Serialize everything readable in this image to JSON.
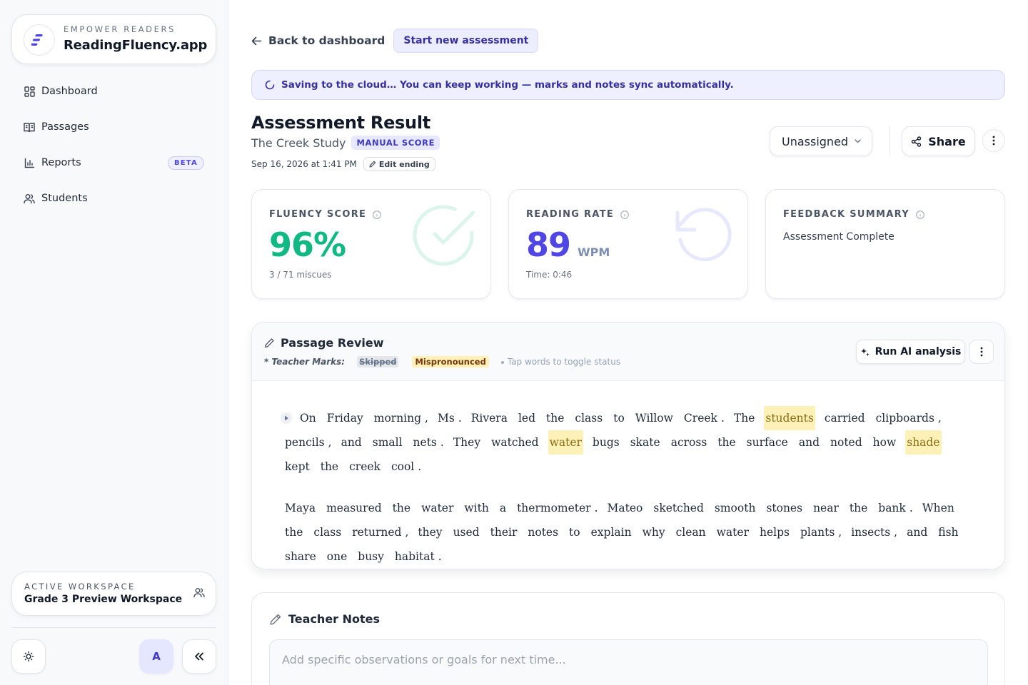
{
  "brand": {
    "kicker": "EMPOWER READERS",
    "name": "ReadingFluency.app"
  },
  "nav": [
    {
      "label": "Dashboard",
      "icon": "dashboard-grid-icon"
    },
    {
      "label": "Passages",
      "icon": "book-open-icon"
    },
    {
      "label": "Reports",
      "icon": "bar-chart-icon",
      "badge": "BETA"
    },
    {
      "label": "Students",
      "icon": "users-icon"
    }
  ],
  "workspace": {
    "kicker": "ACTIVE WORKSPACE",
    "name": "Grade 3 Preview Workspace"
  },
  "footer": {
    "avatar_letter": "A"
  },
  "topbar": {
    "back_label": "Back to dashboard",
    "new_label": "Start new assessment"
  },
  "sync_banner": "Saving to the cloud… You can keep working — marks and notes sync automatically.",
  "assessment": {
    "title": "Assessment Result",
    "passage_name": "The Creek Study",
    "score_badge": "MANUAL SCORE",
    "date": "Sep 16, 2026 at 1:41 PM",
    "edit_label": "Edit ending",
    "assignee": "Unassigned",
    "share_label": "Share"
  },
  "stats": {
    "fluency": {
      "label": "FLUENCY SCORE",
      "value": "96%",
      "foot": "3 / 71 miscues",
      "color": "#10b981"
    },
    "rate": {
      "label": "READING RATE",
      "value": "89",
      "unit": "WPM",
      "foot": "Time: 0:46",
      "color": "#4f46e5"
    },
    "feedback": {
      "label": "FEEDBACK SUMMARY",
      "text": "Assessment Complete"
    }
  },
  "passage_review": {
    "title": "Passage Review",
    "legend_label": "* Teacher Marks:",
    "legend_skipped": "Skipped",
    "legend_mispronounced": "Mispronounced",
    "legend_hint": "Tap words to toggle status",
    "ai_label": "Run AI analysis",
    "paragraphs": [
      [
        {
          "t": "On"
        },
        {
          "t": "Friday"
        },
        {
          "t": "morning"
        },
        {
          "p": ","
        },
        {
          "t": "Ms"
        },
        {
          "p": "."
        },
        {
          "t": "Rivera"
        },
        {
          "t": "led"
        },
        {
          "t": "the"
        },
        {
          "t": "class"
        },
        {
          "t": "to"
        },
        {
          "t": "Willow"
        },
        {
          "t": "Creek"
        },
        {
          "p": "."
        },
        {
          "t": "The"
        },
        {
          "t": "students",
          "m": true
        },
        {
          "t": "carried"
        },
        {
          "t": "clipboards"
        },
        {
          "p": ","
        },
        {
          "t": "pencils"
        },
        {
          "p": ","
        },
        {
          "t": "and"
        },
        {
          "t": "small"
        },
        {
          "t": "nets"
        },
        {
          "p": "."
        },
        {
          "t": "They"
        },
        {
          "t": "watched"
        },
        {
          "t": "water",
          "m": true
        },
        {
          "t": "bugs"
        },
        {
          "t": "skate"
        },
        {
          "t": "across"
        },
        {
          "t": "the"
        },
        {
          "t": "surface"
        },
        {
          "t": "and"
        },
        {
          "t": "noted"
        },
        {
          "t": "how"
        },
        {
          "t": "shade",
          "m": true
        },
        {
          "t": "kept"
        },
        {
          "t": "the"
        },
        {
          "t": "creek"
        },
        {
          "t": "cool"
        },
        {
          "p": "."
        }
      ],
      [
        {
          "t": "Maya"
        },
        {
          "t": "measured"
        },
        {
          "t": "the"
        },
        {
          "t": "water"
        },
        {
          "t": "with"
        },
        {
          "t": "a"
        },
        {
          "t": "thermometer"
        },
        {
          "p": "."
        },
        {
          "t": "Mateo"
        },
        {
          "t": "sketched"
        },
        {
          "t": "smooth"
        },
        {
          "t": "stones"
        },
        {
          "t": "near"
        },
        {
          "t": "the"
        },
        {
          "t": "bank"
        },
        {
          "p": "."
        },
        {
          "t": "When"
        },
        {
          "t": "the"
        },
        {
          "t": "class"
        },
        {
          "t": "returned"
        },
        {
          "p": ","
        },
        {
          "t": "they"
        },
        {
          "t": "used"
        },
        {
          "t": "their"
        },
        {
          "t": "notes"
        },
        {
          "t": "to"
        },
        {
          "t": "explain"
        },
        {
          "t": "why"
        },
        {
          "t": "clean"
        },
        {
          "t": "water"
        },
        {
          "t": "helps"
        },
        {
          "t": "plants"
        },
        {
          "p": ","
        },
        {
          "t": "insects"
        },
        {
          "p": ","
        },
        {
          "t": "and"
        },
        {
          "t": "fish"
        },
        {
          "t": "share"
        },
        {
          "t": "one"
        },
        {
          "t": "busy"
        },
        {
          "t": "habitat"
        },
        {
          "p": "."
        }
      ]
    ]
  },
  "notes": {
    "title": "Teacher Notes",
    "placeholder": "Add specific observations or goals for next time..."
  },
  "colors": {
    "accent": "#4f46e5",
    "success": "#10b981",
    "mispronounced_bg": "#fdf1b8"
  }
}
